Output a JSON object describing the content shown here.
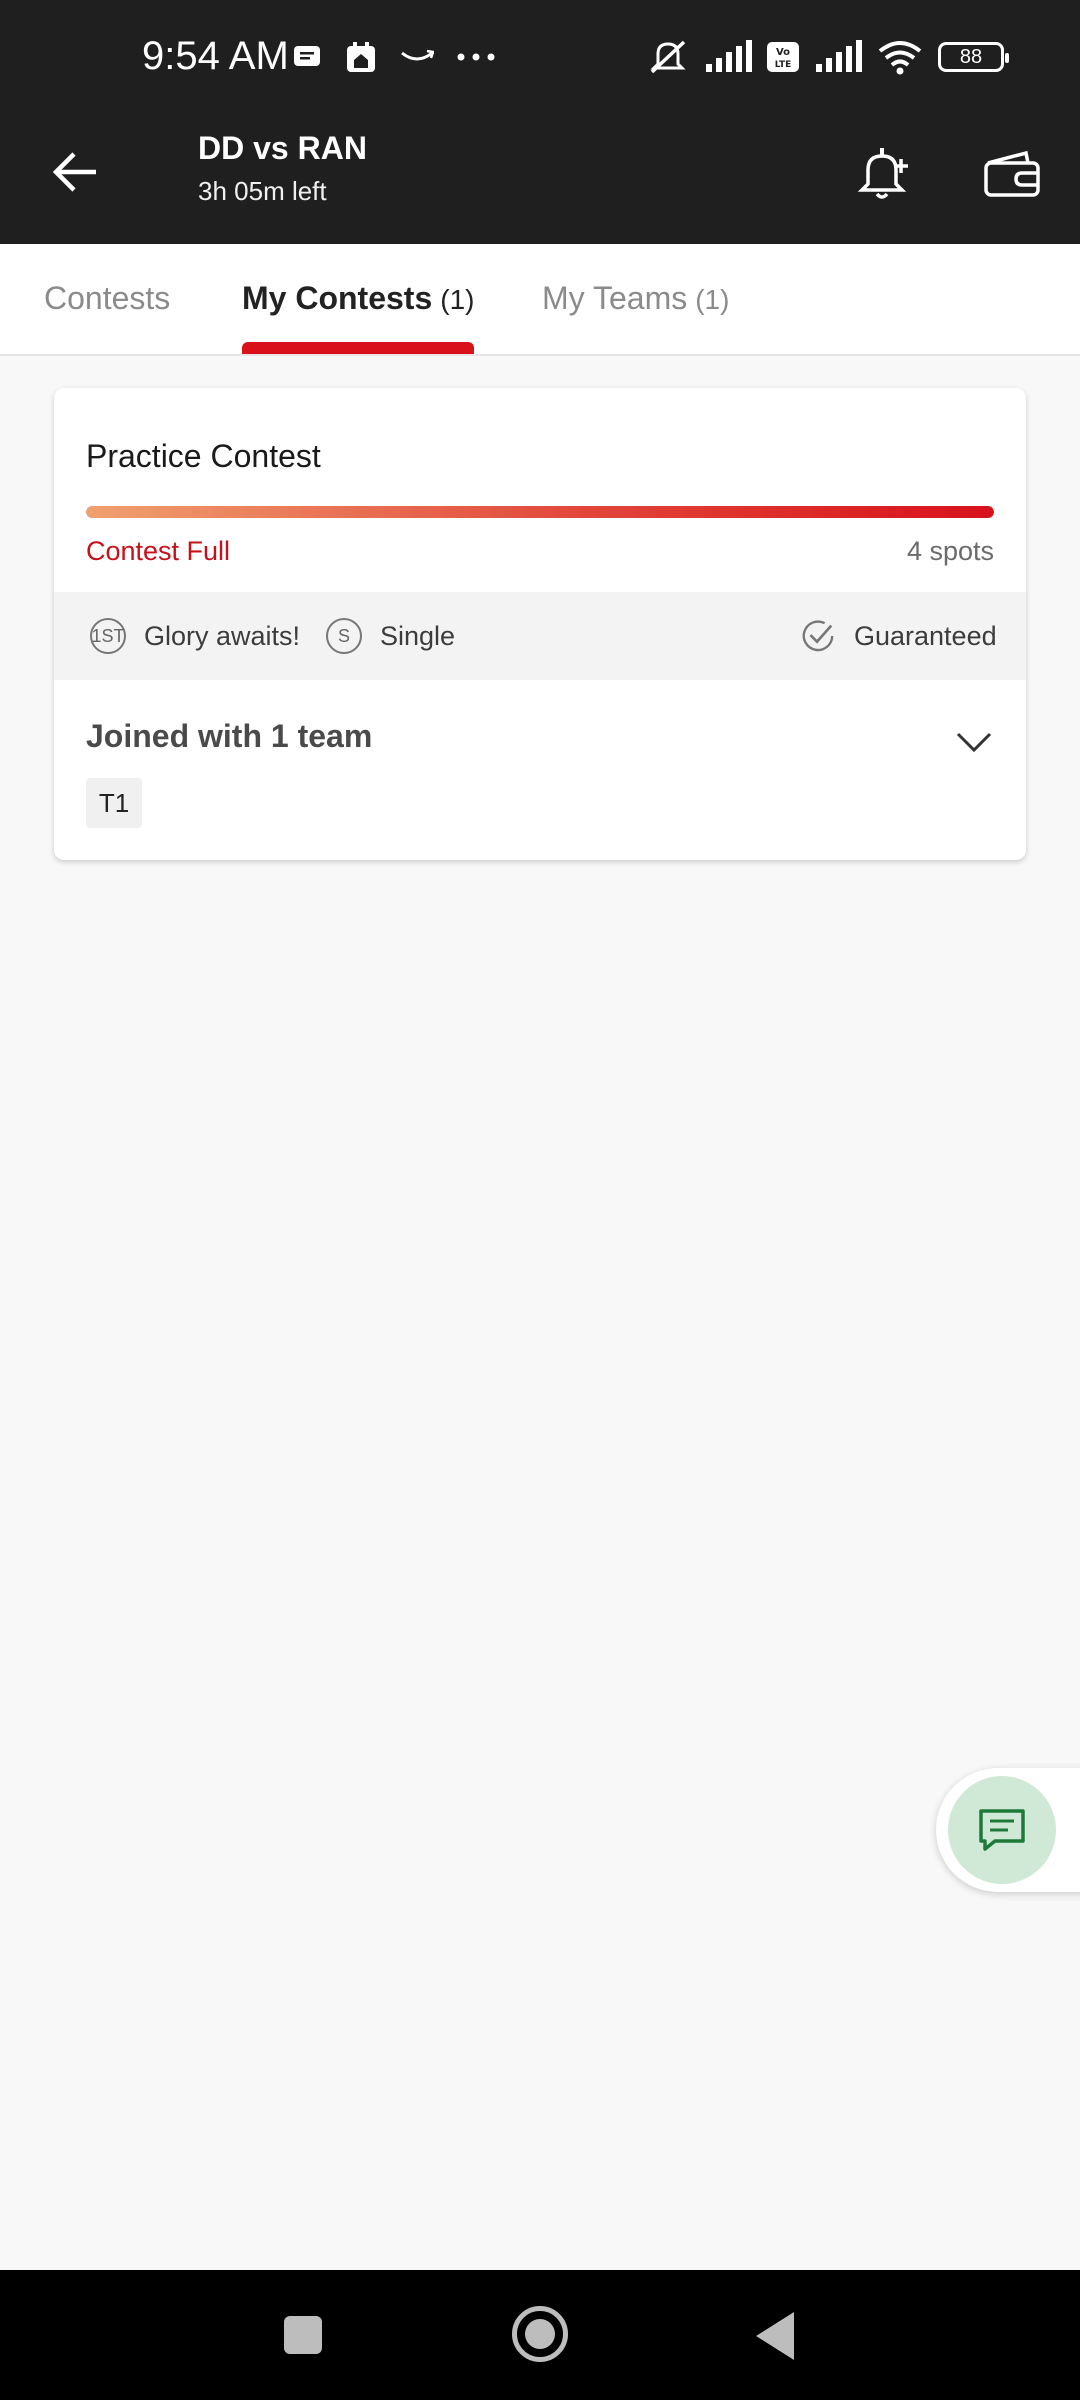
{
  "status_bar": {
    "time": "9:54 AM",
    "battery": "88",
    "left_icons": [
      "message-icon",
      "app-icon",
      "amazon-icon",
      "more-dots-icon"
    ],
    "right_icons": [
      "mute-icon",
      "signal-icon",
      "volte-icon",
      "signal-icon",
      "wifi-icon",
      "battery-icon"
    ]
  },
  "header": {
    "match_title": "DD vs RAN",
    "time_left": "3h 05m left",
    "icons": [
      "back-arrow-icon",
      "bell-plus-icon",
      "wallet-icon"
    ]
  },
  "tabs": [
    {
      "label": "Contests",
      "count": ""
    },
    {
      "label": "My Contests",
      "count": "(1)",
      "active": true
    },
    {
      "label": "My Teams",
      "count": "(1)"
    }
  ],
  "contest": {
    "title": "Practice Contest",
    "fill_fraction": 1.0,
    "status": "Contest Full",
    "spots": "4 spots",
    "tags": {
      "glory_icon_text": "1ST",
      "glory": "Glory awaits!",
      "single_icon_text": "S",
      "single": "Single",
      "guaranteed": "Guaranteed"
    },
    "joined_text": "Joined with 1 team",
    "teams": [
      "T1"
    ]
  },
  "colors": {
    "accent_red": "#d8111b",
    "header_bg": "#1f1f1f",
    "fab_bg": "#cfe9d6",
    "fab_icon": "#1f7a3a"
  }
}
